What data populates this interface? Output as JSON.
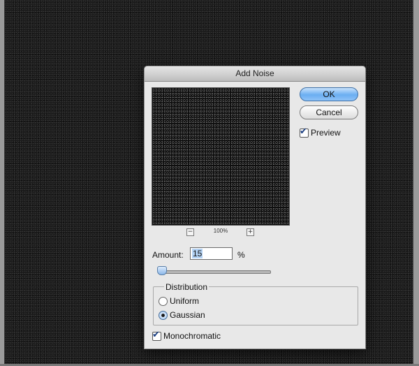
{
  "dialog": {
    "title": "Add Noise",
    "ok_label": "OK",
    "cancel_label": "Cancel",
    "preview": {
      "label": "Preview",
      "checked": true
    },
    "zoom": {
      "minus": "−",
      "level": "100%",
      "plus": "+"
    },
    "amount": {
      "label": "Amount:",
      "value": "15",
      "unit": "%",
      "slider_fraction": 0.04
    },
    "distribution": {
      "title": "Distribution",
      "options": [
        {
          "label": "Uniform",
          "selected": false
        },
        {
          "label": "Gaussian",
          "selected": true
        }
      ]
    },
    "monochromatic": {
      "label": "Monochromatic",
      "checked": true
    }
  },
  "icons": {
    "checkmark": "checkmark-icon"
  },
  "colors": {
    "ok_button": "#6aaef2",
    "dialog_bg": "#e8e8e8",
    "canvas_bg": "#1b1b1b"
  }
}
